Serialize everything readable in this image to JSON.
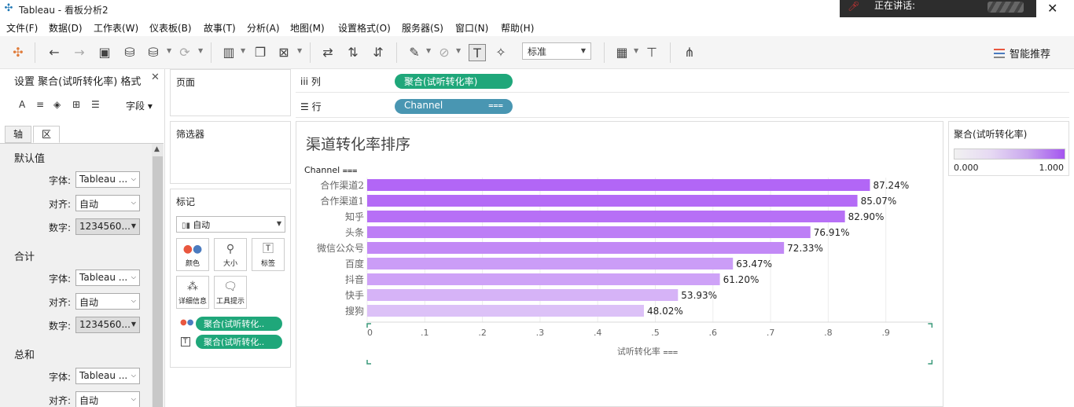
{
  "window": {
    "title": "Tableau - 看板分析2",
    "speaking_label": "正在讲话:"
  },
  "menu": [
    "文件(F)",
    "数据(D)",
    "工作表(W)",
    "仪表板(B)",
    "故事(T)",
    "分析(A)",
    "地图(M)",
    "设置格式(O)",
    "服务器(S)",
    "窗口(N)",
    "帮助(H)"
  ],
  "toolbar": {
    "fit_mode": "标准",
    "smart_label": "智能推荐"
  },
  "format_panel": {
    "title": "设置 聚合(试听转化率) 格式",
    "field_label": "字段",
    "tabs": [
      "轴",
      "区"
    ],
    "sections": [
      {
        "name": "默认值",
        "rows": [
          {
            "label": "字体:",
            "value": "Tableau ..."
          },
          {
            "label": "对齐:",
            "value": "自动"
          },
          {
            "label": "数字:",
            "value": "1234560..."
          }
        ]
      },
      {
        "name": "合计",
        "rows": [
          {
            "label": "字体:",
            "value": "Tableau ..."
          },
          {
            "label": "对齐:",
            "value": "自动"
          },
          {
            "label": "数字:",
            "value": "1234560..."
          }
        ]
      },
      {
        "name": "总和",
        "rows": [
          {
            "label": "字体:",
            "value": "Tableau ..."
          },
          {
            "label": "对齐:",
            "value": "自动"
          }
        ]
      }
    ]
  },
  "pages_title": "页面",
  "filters_title": "筛选器",
  "marks": {
    "title": "标记",
    "type": "自动",
    "buttons": [
      "颜色",
      "大小",
      "标签",
      "详细信息",
      "工具提示"
    ],
    "pills": [
      "聚合(试听转化..",
      "聚合(试听转化.."
    ]
  },
  "shelves": {
    "columns_label": "列",
    "columns_pill": "聚合(试听转化率)",
    "rows_label": "行",
    "rows_pill": "Channel"
  },
  "legend": {
    "title": "聚合(试听转化率)",
    "min": "0.000",
    "max": "1.000"
  },
  "chart_data": {
    "type": "bar",
    "orientation": "horizontal",
    "title": "渠道转化率排序",
    "row_header": "Channel",
    "xlabel": "试听转化率",
    "categories": [
      "合作渠道2",
      "合作渠道1",
      "知乎",
      "头条",
      "微信公众号",
      "百度",
      "抖音",
      "快手",
      "搜狗"
    ],
    "values": [
      0.8724,
      0.8507,
      0.829,
      0.7691,
      0.7233,
      0.6347,
      0.612,
      0.5393,
      0.4802
    ],
    "data_labels": [
      "87.24%",
      "85.07%",
      "82.90%",
      "76.91%",
      "72.33%",
      "63.47%",
      "61.20%",
      "53.93%",
      "48.02%"
    ],
    "xticks": [
      "0",
      ".1",
      ".2",
      ".3",
      ".4",
      ".5",
      ".6",
      ".7",
      ".8",
      ".9"
    ],
    "xlim": [
      0,
      1.0
    ],
    "color_low": "#dcc1f7",
    "color_high": "#b266f6",
    "grid": true
  }
}
